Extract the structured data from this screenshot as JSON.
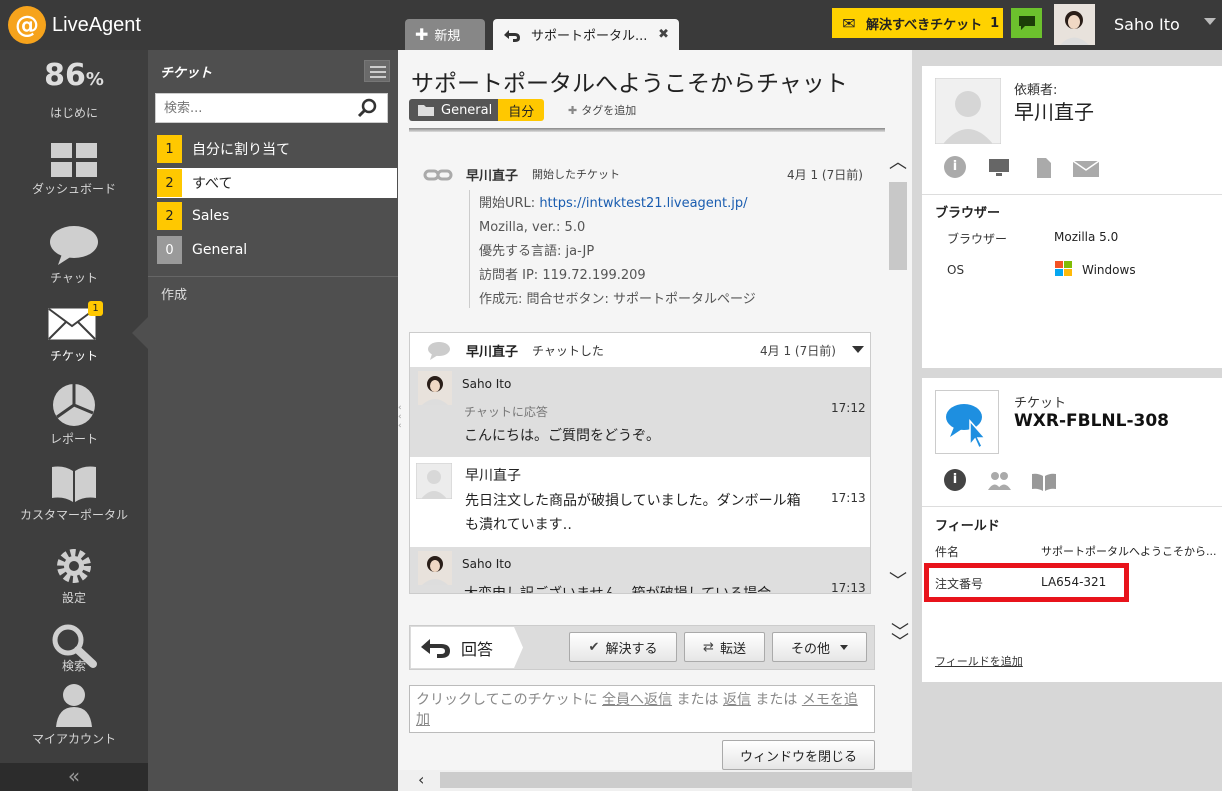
{
  "app": {
    "brand": "LiveAgent"
  },
  "top": {
    "tabs": [
      {
        "label": "新規"
      },
      {
        "label": "サポートポータル..."
      }
    ],
    "alert_label": "解決すべきチケット",
    "alert_count": "1",
    "user_name": "Saho Ito"
  },
  "sidebar": {
    "progress": "86",
    "progress_unit": "%",
    "items": [
      {
        "label": "はじめに"
      },
      {
        "label": "ダッシュボード"
      },
      {
        "label": "チャット"
      },
      {
        "label": "チケット",
        "badge": "1"
      },
      {
        "label": "レポート"
      },
      {
        "label": "カスタマーポータル"
      },
      {
        "label": "設定"
      },
      {
        "label": "検索"
      },
      {
        "label": "マイアカウント"
      }
    ],
    "collapse": "«"
  },
  "tickets_panel": {
    "title": "チケット",
    "search_placeholder": "検索...",
    "queues": [
      {
        "count": "1",
        "label": "自分に割り当て"
      },
      {
        "count": "2",
        "label": "すべて"
      },
      {
        "count": "2",
        "label": "Sales"
      },
      {
        "count": "0",
        "label": "General"
      }
    ],
    "create_label": "作成"
  },
  "main": {
    "subject": "サポートポータルへようこそからチャット",
    "department": "General",
    "assignee": "自分",
    "add_tag": "タグを追加",
    "start_event": {
      "author": "早川直子",
      "action": "開始したチケット",
      "date": "4月 1 (7日前)",
      "details": [
        {
          "label": "開始URL: ",
          "value": "https://intwktest21.liveagent.jp/"
        },
        {
          "label": "Mozilla, ver.: 5.0",
          "value": ""
        },
        {
          "label": "優先する言語: ja-JP",
          "value": ""
        },
        {
          "label": "訪問者 IP: 119.72.199.209",
          "value": ""
        },
        {
          "label": "作成元: 問合せボタン: サポートポータルページ",
          "value": ""
        }
      ]
    },
    "chat": {
      "author": "早川直子",
      "action": "チャットした",
      "date": "4月 1 (7日前)",
      "messages": [
        {
          "name": "Saho Ito",
          "meta": "チャットに応答",
          "text": "こんにちは。ご質問をどうぞ。",
          "time": "17:12"
        },
        {
          "name": "早川直子",
          "text": "先日注文した商品が破損していました。ダンボール箱も潰れています‥",
          "time": "17:13"
        },
        {
          "name": "Saho Ito",
          "text": "大変申し訳ございません。箱が破損している場合",
          "time": "17:13"
        }
      ]
    },
    "reply": {
      "reply_label": "回答",
      "resolve_label": "解決する",
      "transfer_label": "転送",
      "other_label": "その他",
      "compose_prefix": "クリックしてこのチケットに",
      "reply_all": "全員へ返信",
      "or1": "または",
      "reply_one": "返信",
      "or2": "または",
      "note": "メモを追加",
      "close_window": "ウィンドウを閉じる"
    }
  },
  "requester": {
    "label": "依頼者:",
    "name": "早川直子",
    "browser_heading": "ブラウザー",
    "browser_label": "ブラウザー",
    "browser_value": "Mozilla 5.0",
    "os_label": "OS",
    "os_value": "Windows"
  },
  "ticket_info": {
    "label": "チケット",
    "code": "WXR-FBLNL-308",
    "fields_heading": "フィールド",
    "fields": [
      {
        "label": "件名",
        "value": "サポートポータルへようこそから..."
      },
      {
        "label": "注文番号",
        "value": "LA654-321"
      }
    ],
    "add_field": "フィールドを追加",
    "highlight_color": "#e8131b"
  }
}
